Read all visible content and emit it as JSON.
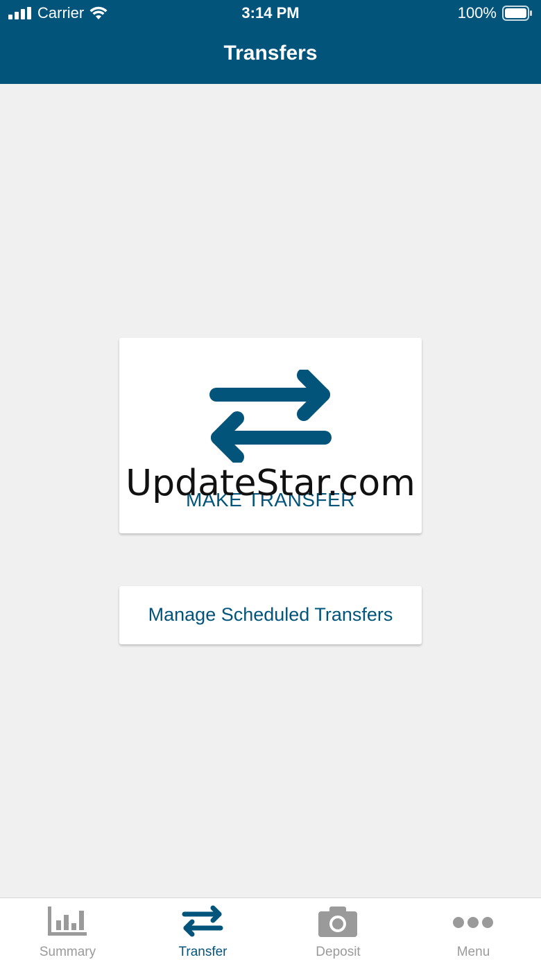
{
  "status_bar": {
    "carrier": "Carrier",
    "time": "3:14 PM",
    "battery": "100%"
  },
  "header": {
    "title": "Transfers"
  },
  "main": {
    "make_transfer_label": "MAKE TRANSFER",
    "manage_label": "Manage Scheduled Transfers",
    "watermark": "UpdateStar.com"
  },
  "tabbar": {
    "active": "Transfer",
    "items": [
      {
        "label": "Summary",
        "icon": "bar-chart-icon"
      },
      {
        "label": "Transfer",
        "icon": "transfer-arrows-icon"
      },
      {
        "label": "Deposit",
        "icon": "camera-icon"
      },
      {
        "label": "Menu",
        "icon": "more-dots-icon"
      }
    ]
  },
  "colors": {
    "brand": "#02547b",
    "background": "#f0f0f0",
    "inactive_tab": "#9a9a9a"
  }
}
